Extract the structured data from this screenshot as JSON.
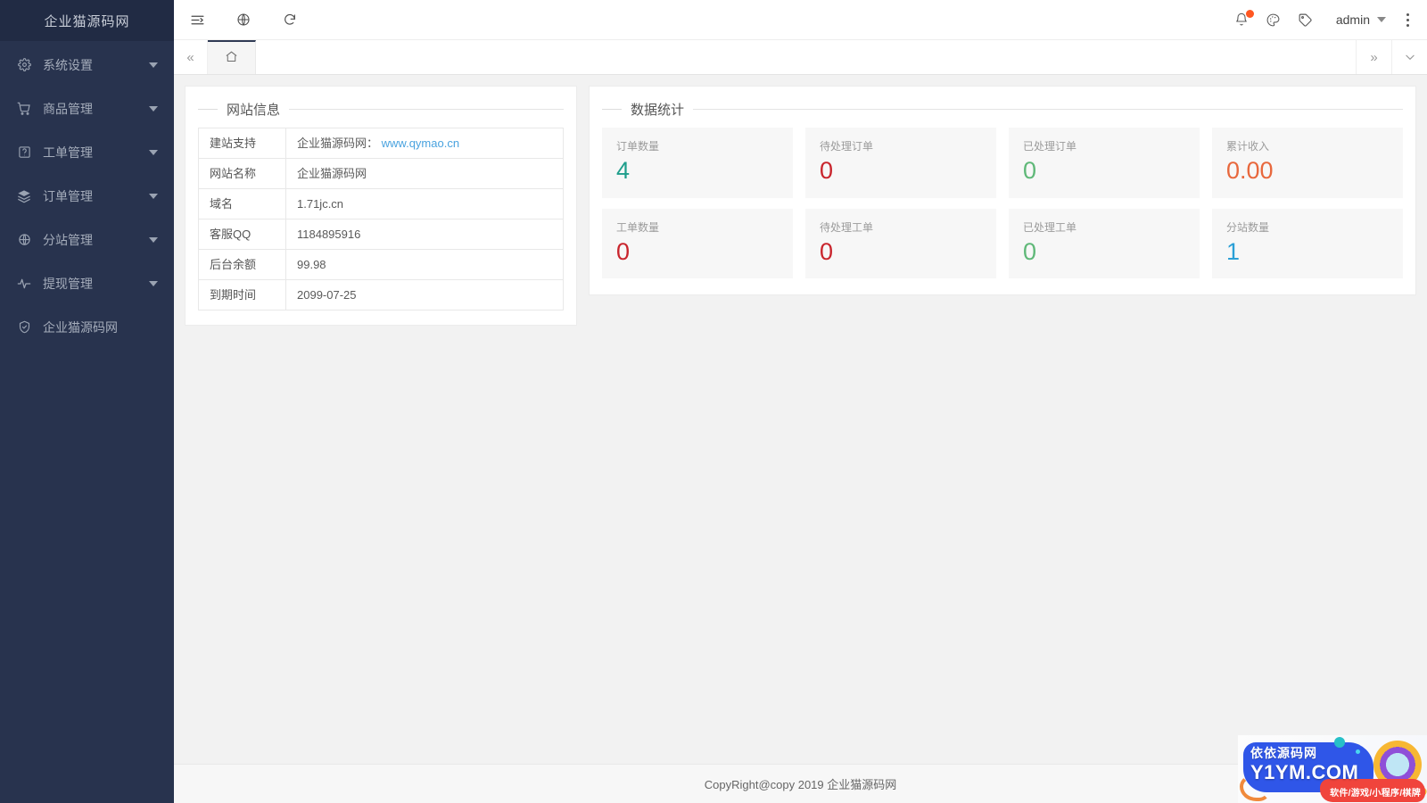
{
  "sidebar": {
    "logo": "企业猫源码网",
    "items": [
      {
        "label": "系统设置",
        "icon": "gear-icon",
        "has_submenu": true
      },
      {
        "label": "商品管理",
        "icon": "cart-icon",
        "has_submenu": true
      },
      {
        "label": "工单管理",
        "icon": "ticket-icon",
        "has_submenu": true
      },
      {
        "label": "订单管理",
        "icon": "layers-icon",
        "has_submenu": true
      },
      {
        "label": "分站管理",
        "icon": "globe-icon",
        "has_submenu": true
      },
      {
        "label": "提现管理",
        "icon": "pulse-icon",
        "has_submenu": true
      },
      {
        "label": "企业猫源码网",
        "icon": "shield-icon",
        "has_submenu": false
      }
    ]
  },
  "topbar": {
    "left_buttons": [
      {
        "name": "menu-toggle-icon",
        "title": "折叠菜单"
      },
      {
        "name": "globe-icon",
        "title": "前台首页"
      },
      {
        "name": "refresh-icon",
        "title": "刷新"
      }
    ],
    "right_icons": [
      {
        "name": "bell-icon",
        "title": "通知",
        "badge": true
      },
      {
        "name": "palette-icon",
        "title": "主题"
      },
      {
        "name": "tag-icon",
        "title": "标签"
      }
    ],
    "user": "admin"
  },
  "tabbar": {
    "prev_label": "«",
    "next_label": "»",
    "home_tab": "首页",
    "dropdown_label": "∨"
  },
  "info_panel": {
    "title": "网站信息",
    "rows": [
      {
        "key": "建站支持",
        "value": "企业猫源码网：",
        "link": "www.qymao.cn"
      },
      {
        "key": "网站名称",
        "value": "企业猫源码网",
        "link": ""
      },
      {
        "key": "域名",
        "value": "1.71jc.cn",
        "link": ""
      },
      {
        "key": "客服QQ",
        "value": "1184895916",
        "link": ""
      },
      {
        "key": "后台余额",
        "value": "99.98",
        "link": ""
      },
      {
        "key": "到期时间",
        "value": "2099-07-25",
        "link": ""
      }
    ]
  },
  "stats_panel": {
    "title": "数据统计",
    "cards": [
      {
        "label": "订单数量",
        "value": "4",
        "color": "#1f9e8c"
      },
      {
        "label": "待处理订单",
        "value": "0",
        "color": "#c9252d"
      },
      {
        "label": "已处理订单",
        "value": "0",
        "color": "#5fb878"
      },
      {
        "label": "累计收入",
        "value": "0.00",
        "color": "#e8683d"
      },
      {
        "label": "工单数量",
        "value": "0",
        "color": "#c9252d"
      },
      {
        "label": "待处理工单",
        "value": "0",
        "color": "#c9252d"
      },
      {
        "label": "已处理工单",
        "value": "0",
        "color": "#5fb878"
      },
      {
        "label": "分站数量",
        "value": "1",
        "color": "#2a9fd6"
      }
    ]
  },
  "footer": {
    "text": "CopyRight@copy 2019 企业猫源码网"
  },
  "watermark": {
    "cn_name": "依依源码网",
    "en_name": "Y1YM.COM",
    "tagline": "软件/游戏/小程序/棋牌"
  },
  "colors": {
    "sidebar_bg": "#28334e",
    "sidebar_header_bg": "#212b44",
    "accent_link": "#4aa3df",
    "notification_dot": "#ff5722",
    "content_bg": "#f2f2f2"
  }
}
